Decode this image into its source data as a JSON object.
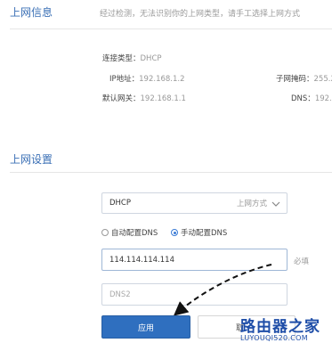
{
  "internet_info": {
    "title": "上网信息",
    "notice": "经过检测，无法识别你的上网类型，请手工选择上网方式",
    "connection_type_label": "连接类型：",
    "connection_type_value": "DHCP",
    "ip_label": "IP地址：",
    "ip_value": "192.168.1.2",
    "subnet_label": "子网掩码：",
    "subnet_value": "255.2",
    "gateway_label": "默认网关：",
    "gateway_value": "192.168.1.1",
    "dns_label": "DNS：",
    "dns_value": "192."
  },
  "internet_settings": {
    "title": "上网设置",
    "mode_select": {
      "value": "DHCP",
      "hint": "上网方式"
    },
    "dns_auto_label": "自动配置DNS",
    "dns_manual_label": "手动配置DNS",
    "dns_mode": "manual",
    "dns1_value": "114.114.114.114",
    "dns1_required": "必填",
    "dns2_placeholder": "DNS2",
    "apply_label": "应用",
    "cancel_label": "取"
  },
  "watermark": {
    "brand": "路由器之家",
    "url": "LUYOUQI520.COM"
  },
  "colors": {
    "accent": "#2f6fbf",
    "title_blue": "#3a6fb5"
  }
}
